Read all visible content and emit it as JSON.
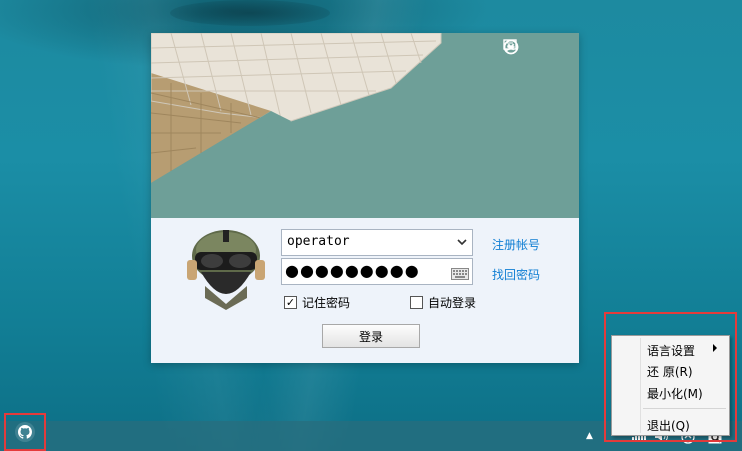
{
  "login": {
    "account_value": "operator",
    "password_mask": "●●●●●●●●●",
    "register_link": "注册帐号",
    "recover_link": "找回密码",
    "remember_label": "记住密码",
    "remember_checked": true,
    "auto_login_label": "自动登录",
    "auto_login_checked": false,
    "login_button": "登录"
  },
  "context_menu": {
    "items": [
      {
        "label": "语言设置",
        "has_submenu": true
      },
      {
        "label": "还 原(R)"
      },
      {
        "label": "最小化(M)"
      },
      {
        "label": "退出(Q)"
      }
    ]
  },
  "colors": {
    "link": "#0f7ed3",
    "highlight_border": "#e43b3b",
    "banner_bg": "#6c9f96",
    "form_bg": "#eef3fa"
  },
  "icons": {
    "title_bar": [
      "feedback-icon",
      "minimize-icon",
      "close-icon"
    ],
    "taskbar_start": "github-octocat-icon",
    "tray": [
      "tray-expand-arrow-icon",
      "network-icon",
      "volume-icon",
      "upload-icon",
      "app-icon"
    ]
  }
}
